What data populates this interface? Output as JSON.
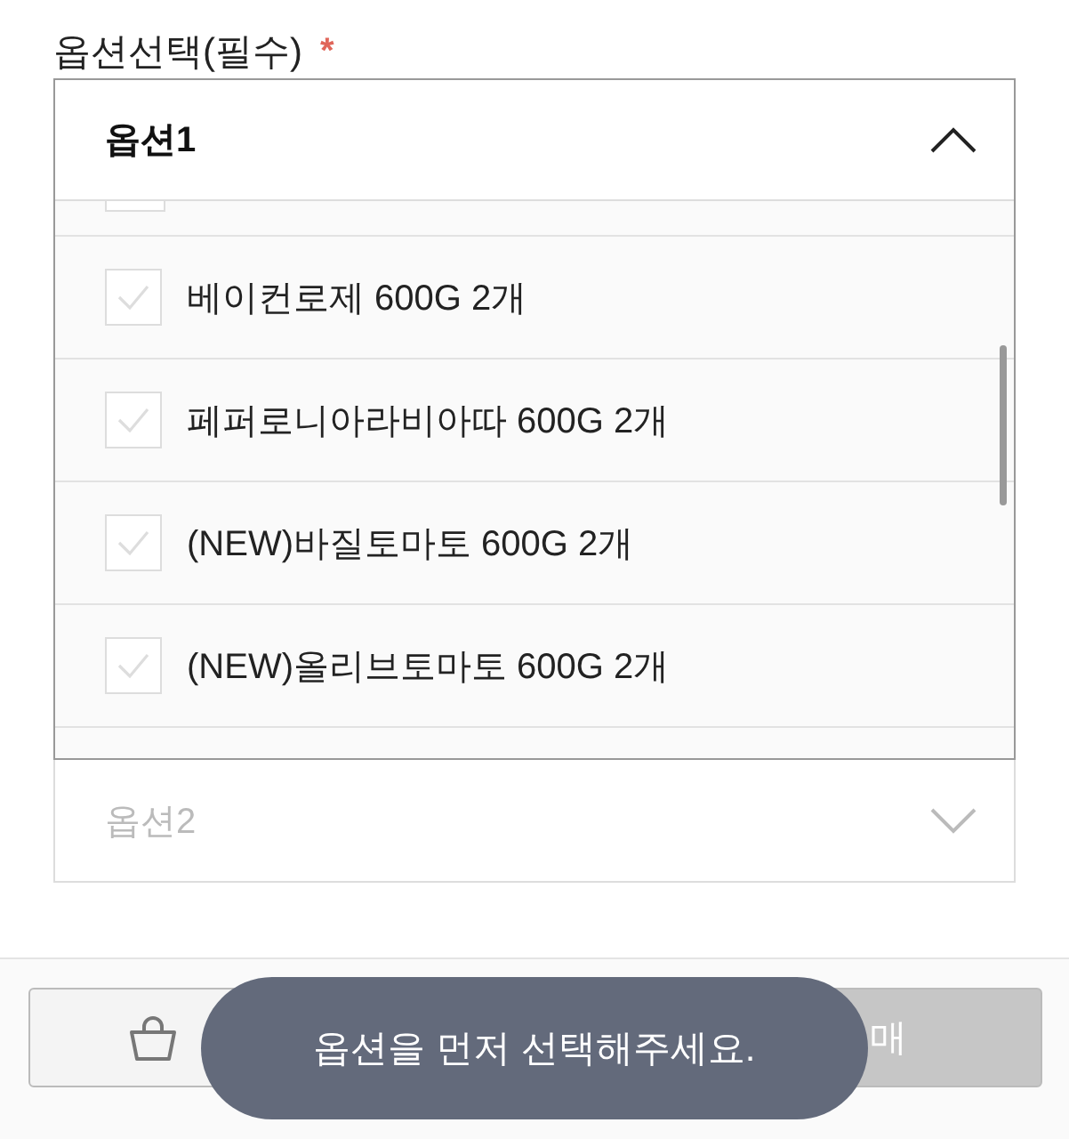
{
  "field_label": "옵션선택(필수)",
  "required_mark": "*",
  "dropdowns": [
    {
      "title": "옵션1",
      "expanded": true,
      "options": [
        {
          "kind": "cut_off",
          "checked": false
        },
        {
          "label": "베이컨로제 600G 2개",
          "checked": false
        },
        {
          "label": "페퍼로니아라비아따 600G 2개",
          "checked": false
        },
        {
          "label": "(NEW)바질토마토 600G 2개",
          "checked": false
        },
        {
          "label": "(NEW)올리브토마토 600G 2개",
          "checked": false
        }
      ]
    },
    {
      "title": "옵션2",
      "expanded": false,
      "disabled": true
    }
  ],
  "buy_button": {
    "label": "매"
  },
  "toast": "옵션을 먼저 선택해주세요."
}
